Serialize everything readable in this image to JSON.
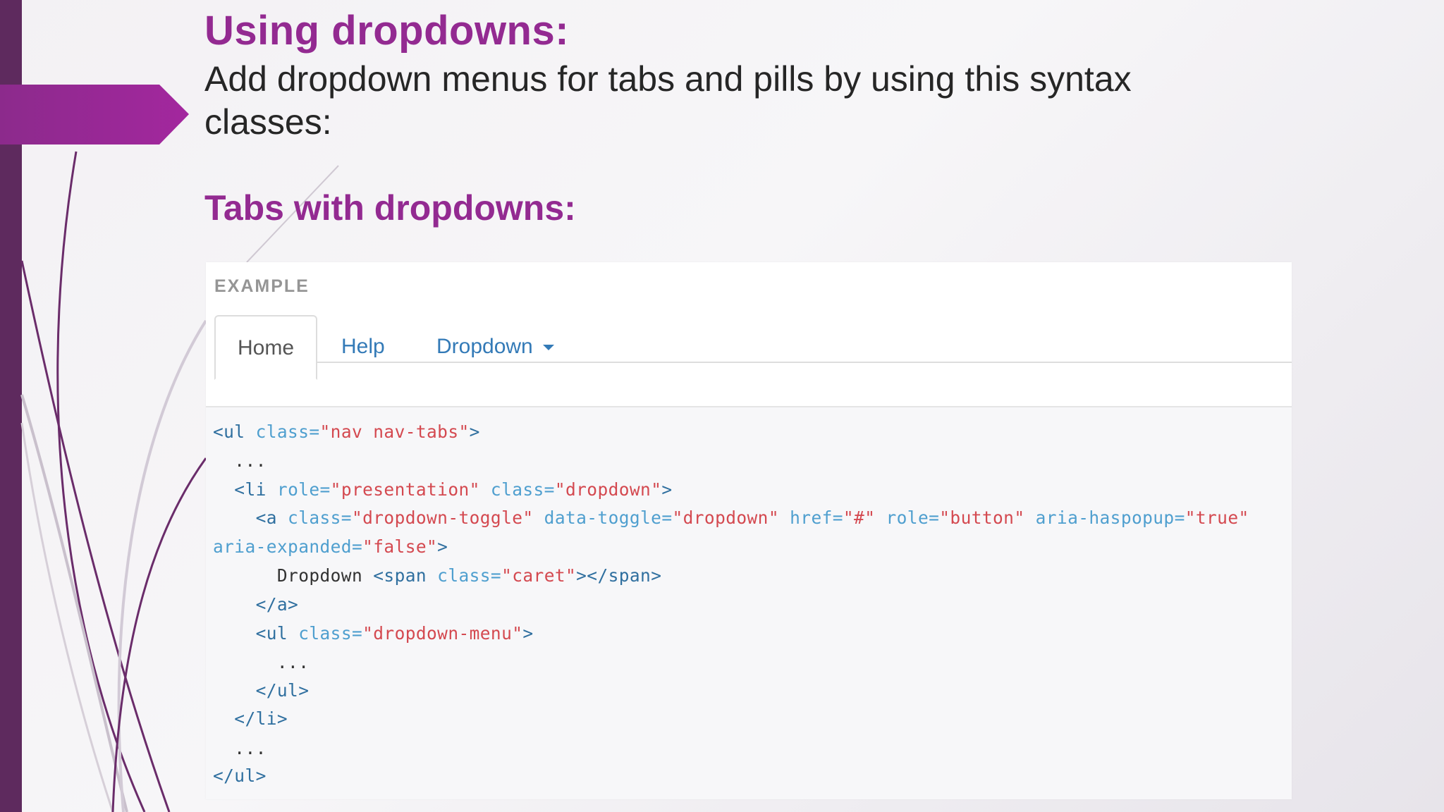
{
  "slide": {
    "title": "Using dropdowns:",
    "body": "Add dropdown menus for tabs and pills by using this syntax classes:",
    "subtitle": "Tabs with dropdowns:"
  },
  "example": {
    "label": "EXAMPLE",
    "tabs": [
      {
        "label": "Home",
        "active": true
      },
      {
        "label": "Help",
        "active": false
      },
      {
        "label": "Dropdown",
        "active": false
      }
    ]
  },
  "code": {
    "line1": {
      "t1": "<ul",
      "a1": " class=",
      "s1": "\"nav nav-tabs\"",
      "t2": ">"
    },
    "line2": "  ...",
    "line3": {
      "t1": "  <li",
      "a1": " role=",
      "s1": "\"presentation\"",
      "a2": " class=",
      "s2": "\"dropdown\"",
      "t2": ">"
    },
    "line4": {
      "t1": "    <a",
      "a1": " class=",
      "s1": "\"dropdown-toggle\"",
      "a2": " data-toggle=",
      "s2": "\"dropdown\"",
      "a3": " href=",
      "s3": "\"#\"",
      "a4": " role=",
      "s4": "\"button\"",
      "a5": " aria-haspopup=",
      "s5": "\"true\""
    },
    "line5": {
      "a1": "aria-expanded=",
      "s1": "\"false\"",
      "t1": ">"
    },
    "line6": {
      "p1": "      Dropdown ",
      "t1": "<span",
      "a1": " class=",
      "s1": "\"caret\"",
      "t2": "></span>"
    },
    "line7": "    </a>",
    "line8": {
      "t1": "    <ul",
      "a1": " class=",
      "s1": "\"dropdown-menu\"",
      "t2": ">"
    },
    "line9": "      ...",
    "line10": "    </ul>",
    "line11": "  </li>",
    "line12": "  ...",
    "line13": "</ul>"
  },
  "colors": {
    "accent": "#932a91",
    "sidebar": "#5e2a5e",
    "link": "#337ab7"
  }
}
